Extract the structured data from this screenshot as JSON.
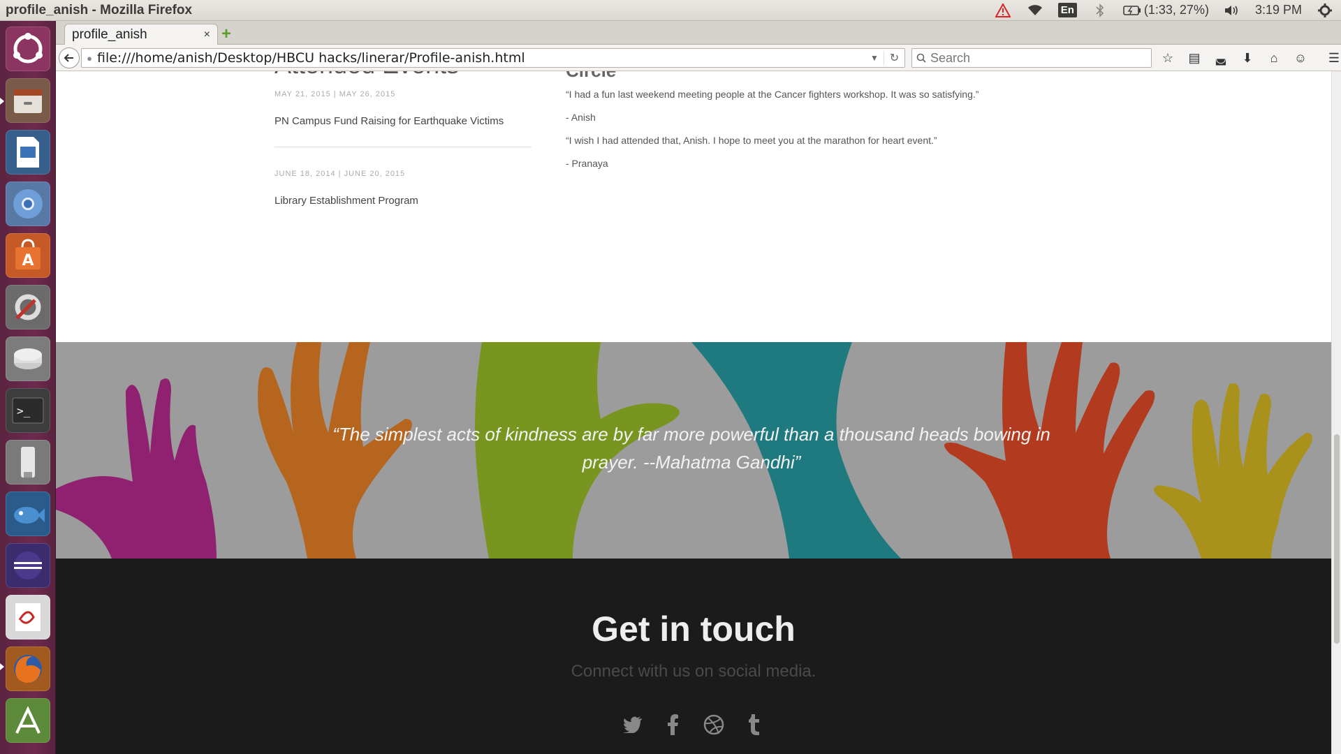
{
  "window": {
    "title": "profile_anish - Mozilla Firefox"
  },
  "tray": {
    "keyboard": "En",
    "battery": "(1:33, 27%)",
    "time": "3:19 PM",
    "icons": [
      "warning-icon",
      "wifi-icon",
      "keyboard-layout-icon",
      "bluetooth-icon",
      "battery-icon",
      "volume-icon",
      "clock",
      "settings-gear-icon"
    ]
  },
  "launcher": {
    "items": [
      "ubuntu-dash",
      "files",
      "libreoffice-impress",
      "chromium",
      "ubuntu-software-center",
      "system-settings",
      "disk",
      "terminal",
      "usb-creator",
      "bluefish",
      "eclipse",
      "evince",
      "firefox",
      "android-studio"
    ]
  },
  "browser": {
    "tab_title": "profile_anish",
    "tab_close": "×",
    "new_tab": "+",
    "url": "file:///home/anish/Desktop/HBCU hacks/linerar/Profile-anish.html",
    "search_placeholder": "Search"
  },
  "events": {
    "heading": "Attended Events",
    "items": [
      {
        "dates": "MAY 21, 2015 | MAY 26, 2015",
        "title": "PN Campus Fund Raising for Earthquake Victims"
      },
      {
        "dates": "JUNE 18, 2014 | JUNE 20, 2015",
        "title": "Library Establishment Program"
      }
    ]
  },
  "circle": {
    "heading": "Circle",
    "messages": [
      "“I had a fun last weekend meeting people at the Cancer fighters workshop. It was so satisfying.”",
      "- Anish",
      "“I wish I had attended that, Anish. I hope to meet you at the marathon for heart event.”",
      "- Pranaya"
    ]
  },
  "quote": {
    "text": "“The simplest acts of kindness are by far more powerful than a thousand heads bowing in prayer. --Mahatma Gandhi”",
    "hand_colors": [
      "#8f2170",
      "#b5651e",
      "#78951f",
      "#1f7a80",
      "#b23a1f",
      "#a8921b"
    ]
  },
  "footer": {
    "title": "Get in touch",
    "subtitle": "Connect with us on social media.",
    "social": [
      "twitter-icon",
      "facebook-icon",
      "dribbble-icon",
      "tumblr-icon"
    ]
  },
  "colors": {
    "launcher_bg": "#6e2a4e",
    "quote_band_bg": "#9c9c9c",
    "footer_bg": "#1b1b1b"
  }
}
